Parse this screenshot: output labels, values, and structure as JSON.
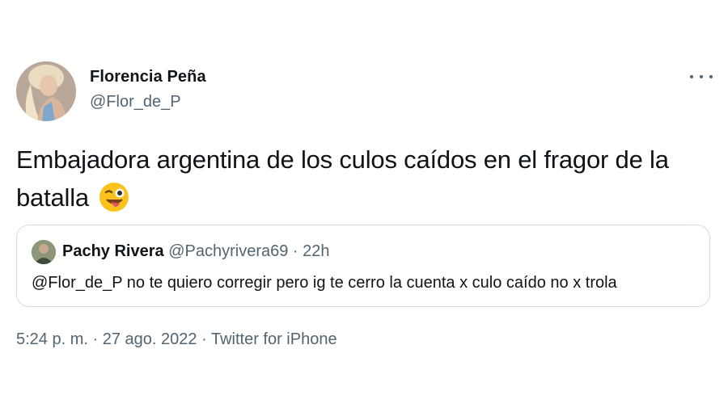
{
  "author": {
    "name": "Florencia Peña",
    "handle": "@Flor_de_P"
  },
  "tweet": {
    "text": "Embajadora argentina de los culos caídos en el fragor de la batalla",
    "emoji_icon": "winking-face-with-tongue-icon"
  },
  "quoted_tweet": {
    "name": "Pachy Rivera",
    "handle": "@Pachyrivera69",
    "separator": "·",
    "time": "22h",
    "text": "@Flor_de_P no te quiero corregir pero ig te cerro la cuenta x culo caído no x trola"
  },
  "meta": {
    "time": "5:24 p. m.",
    "separator": "·",
    "date": "27 ago. 2022",
    "source": "Twitter for iPhone"
  },
  "colors": {
    "text": "#0f1419",
    "secondary": "#536471",
    "border": "#d5dce1"
  }
}
